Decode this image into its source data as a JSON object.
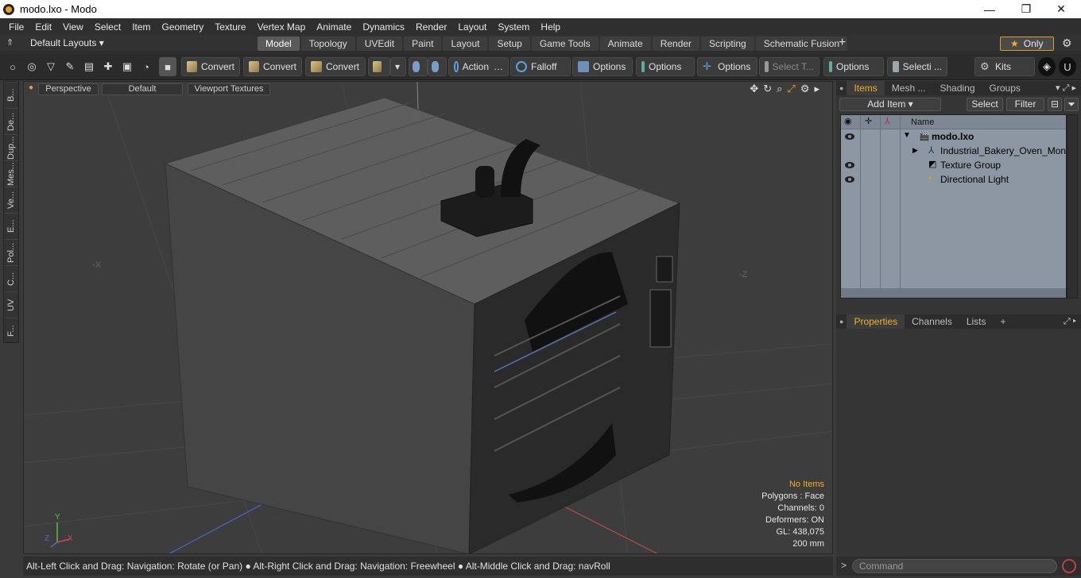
{
  "window": {
    "title": "modo.lxo - Modo"
  },
  "menu": [
    "File",
    "Edit",
    "View",
    "Select",
    "Item",
    "Geometry",
    "Texture",
    "Vertex Map",
    "Animate",
    "Dynamics",
    "Render",
    "Layout",
    "System",
    "Help"
  ],
  "layoutbar": {
    "default_layouts": "Default Layouts ▾",
    "tabs": [
      "Model",
      "Topology",
      "UVEdit",
      "Paint",
      "Layout",
      "Setup",
      "Game Tools",
      "Animate",
      "Render",
      "Scripting",
      "Schematic Fusion"
    ],
    "active_tab": "Model",
    "only_label": "Only"
  },
  "toolbar": {
    "convert1": "Convert",
    "convert2": "Convert",
    "convert3": "Convert",
    "action": "Action",
    "falloff": "Falloff",
    "options1": "Options",
    "options2": "Options",
    "options3": "Options",
    "select_t": "Select T...",
    "options4": "Options",
    "selecti": "Selecti ...",
    "kits": "Kits"
  },
  "lefttabs": [
    "B...",
    "De...",
    "Dup...",
    "Mes...",
    "Ve...",
    "E...",
    "Pol...",
    "C...",
    "UV",
    "F..."
  ],
  "viewport": {
    "perspective": "Perspective",
    "default": "Default",
    "textures": "Viewport Textures",
    "axis_x": "X",
    "axis_y": "Y",
    "axis_z": "Z",
    "label_neg_x": "-X",
    "label_neg_z": "-Z"
  },
  "stats": {
    "no_items": "No Items",
    "polygons": "Polygons : Face",
    "channels": "Channels: 0",
    "deformers": "Deformers: ON",
    "gl": "GL: 438,075",
    "scale": "200 mm"
  },
  "status": "Alt-Left Click and Drag: Navigation: Rotate (or Pan) ● Alt-Right Click and Drag: Navigation: Freewheel ● Alt-Middle Click and Drag: navRoll",
  "items_panel": {
    "tabs": [
      "Items",
      "Mesh ...",
      "Shading",
      "Groups"
    ],
    "add_item": "Add Item",
    "select": "Select",
    "filter": "Filter",
    "name_header": "Name",
    "rows": [
      {
        "label": "modo.lxo"
      },
      {
        "label": "Industrial_Bakery_Oven_Mon ..."
      },
      {
        "label": "Texture Group"
      },
      {
        "label": "Directional Light"
      }
    ]
  },
  "properties_panel": {
    "tabs": [
      "Properties",
      "Channels",
      "Lists"
    ]
  },
  "command": {
    "placeholder": "Command"
  }
}
